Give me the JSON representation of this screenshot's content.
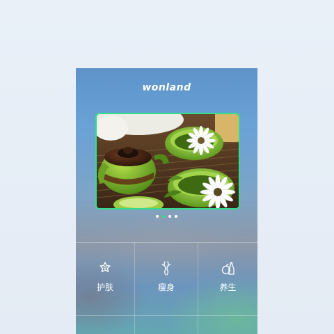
{
  "app": {
    "logo": "wonland"
  },
  "slider": {
    "image_alt": "tea set",
    "slide_count": 4,
    "active_index": 1
  },
  "categories": [
    {
      "label": "护肤",
      "icon": "flower-icon"
    },
    {
      "label": "瘦身",
      "icon": "body-figure-icon"
    },
    {
      "label": "养生",
      "icon": "fruit-bottle-icon"
    }
  ],
  "colors": {
    "accent": "#2fe08a",
    "text": "#ffffff"
  }
}
